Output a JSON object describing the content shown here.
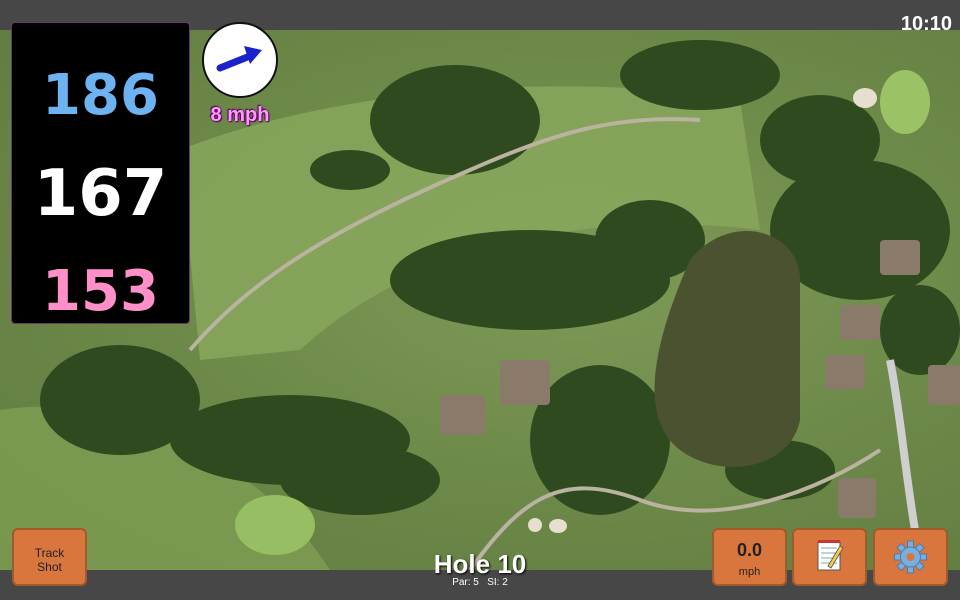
{
  "status": {
    "time": "10:10"
  },
  "distances": {
    "back": "186",
    "middle": "167",
    "front": "153"
  },
  "wind": {
    "speed": "8 mph",
    "icon": "wind-direction-arrow-icon"
  },
  "hole": {
    "title": "Hole 10",
    "par": "Par: 5",
    "si": "SI: 2"
  },
  "buttons": {
    "track_shot_line1": "Track",
    "track_shot_line2": "Shot",
    "shot_value": "0.0",
    "shot_unit": "mph",
    "notes_icon": "notepad-icon",
    "settings_icon": "gear-icon"
  },
  "colors": {
    "back_distance": "#6db3f2",
    "middle_distance": "#ffffff",
    "front_distance": "#ff8fc8",
    "wind_text": "#ff99ff",
    "button": "#d9763d"
  }
}
